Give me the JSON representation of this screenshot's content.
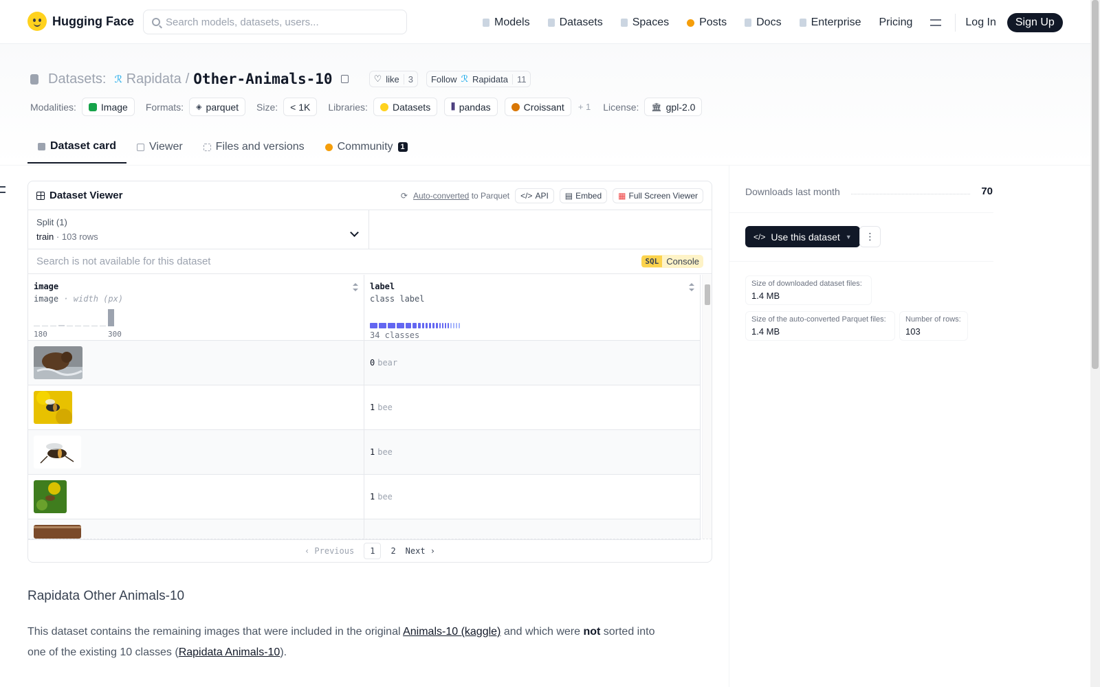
{
  "brand": {
    "name": "Hugging Face"
  },
  "search": {
    "placeholder": "Search models, datasets, users..."
  },
  "nav": {
    "items": [
      {
        "label": "Models"
      },
      {
        "label": "Datasets"
      },
      {
        "label": "Spaces"
      },
      {
        "label": "Posts"
      },
      {
        "label": "Docs"
      },
      {
        "label": "Enterprise"
      },
      {
        "label": "Pricing"
      }
    ],
    "login": "Log In",
    "signup": "Sign Up"
  },
  "header": {
    "section": "Datasets:",
    "org": "Rapidata",
    "slash": "/",
    "name": "Other-Animals-10",
    "like_label": "like",
    "like_count": "3",
    "follow_label": "Follow",
    "follow_org": "Rapidata",
    "follow_count": "11"
  },
  "meta": {
    "modalities_label": "Modalities:",
    "modality": "Image",
    "formats_label": "Formats:",
    "format": "parquet",
    "size_label": "Size:",
    "size": "< 1K",
    "libraries_label": "Libraries:",
    "libraries": [
      "Datasets",
      "pandas",
      "Croissant"
    ],
    "libraries_more": "+ 1",
    "license_label": "License:",
    "license": "gpl-2.0"
  },
  "tabs": [
    {
      "label": "Dataset card"
    },
    {
      "label": "Viewer"
    },
    {
      "label": "Files and versions"
    },
    {
      "label": "Community",
      "badge": "1"
    }
  ],
  "viewer": {
    "title": "Dataset Viewer",
    "auto_converted": "Auto-converted",
    "to_parquet": "to Parquet",
    "api": "API",
    "embed": "Embed",
    "fullscreen": "Full Screen Viewer",
    "split_label": "Split (1)",
    "split_name": "train",
    "split_dot": "·",
    "split_rows": "103 rows",
    "search_text": "Search is not available for this dataset",
    "sql": "SQL",
    "console": "Console",
    "columns": [
      {
        "name": "image",
        "type": "image",
        "subtype": "· width (px)",
        "min": "180",
        "max": "300"
      },
      {
        "name": "label",
        "type": "class label",
        "classes": "34 classes"
      }
    ],
    "rows": [
      {
        "label_id": "0",
        "label_name": "bear"
      },
      {
        "label_id": "1",
        "label_name": "bee"
      },
      {
        "label_id": "1",
        "label_name": "bee"
      },
      {
        "label_id": "1",
        "label_name": "bee"
      }
    ],
    "pager": {
      "prev": "Previous",
      "pages": [
        "1",
        "2"
      ],
      "next": "Next"
    }
  },
  "sidebar": {
    "downloads_label": "Downloads last month",
    "downloads_value": "70",
    "use_button": "Use this dataset",
    "stats": [
      {
        "label": "Size of downloaded dataset files:",
        "value": "1.4 MB"
      },
      {
        "label": "Size of the auto-converted Parquet files:",
        "value": "1.4 MB"
      },
      {
        "label": "Number of rows:",
        "value": "103"
      }
    ]
  },
  "card": {
    "heading": "Rapidata Other Animals-10",
    "p1": "This dataset contains the remaining images that were included in the original ",
    "link1": "Animals-10 (kaggle)",
    "p2": " and which were ",
    "bold": "not",
    "p3": " sorted into one of the existing 10 classes (",
    "link2": "Rapidata Animals-10",
    "p4": ")."
  }
}
